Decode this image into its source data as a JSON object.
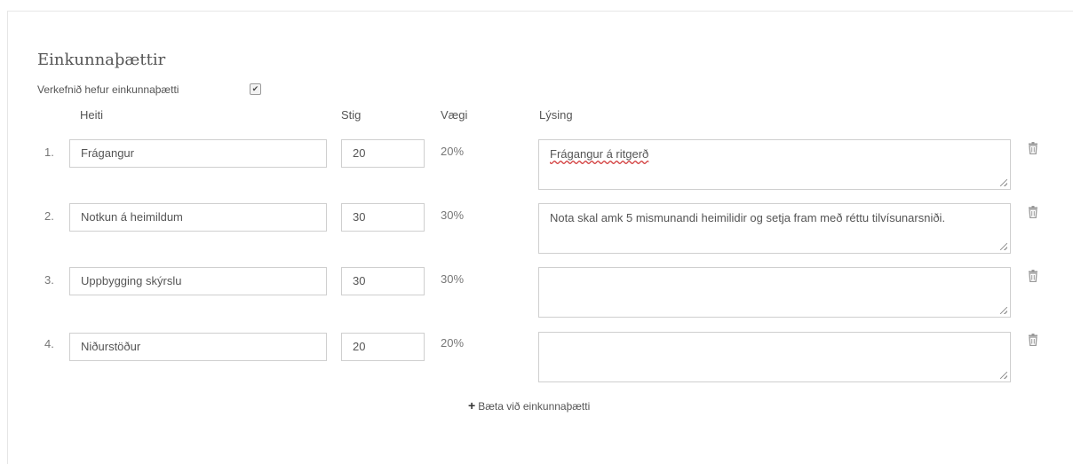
{
  "section": {
    "title": "Einkunnaþættir",
    "has_rubric_label": "Verkefnið hefur einkunnaþætti",
    "has_rubric_checked": true
  },
  "columns": {
    "name": "Heiti",
    "points": "Stig",
    "weight": "Vægi",
    "description": "Lýsing"
  },
  "rows": [
    {
      "num": "1.",
      "name": "Frágangur",
      "points": "20",
      "weight": "20%",
      "description": "Frágangur á ritgerð"
    },
    {
      "num": "2.",
      "name": "Notkun á  heimildum",
      "points": "30",
      "weight": "30%",
      "description": "Nota skal amk 5 mismunandi heimilidir og setja fram með réttu tilvísunarsniði."
    },
    {
      "num": "3.",
      "name": "Uppbygging skýrslu",
      "points": "30",
      "weight": "30%",
      "description": ""
    },
    {
      "num": "4.",
      "name": "Niðurstöður",
      "points": "20",
      "weight": "20%",
      "description": ""
    }
  ],
  "add_button": {
    "icon": "plus-icon",
    "label": "Bæta við einkunnaþætti"
  },
  "row_delete_icon": "trash-icon"
}
